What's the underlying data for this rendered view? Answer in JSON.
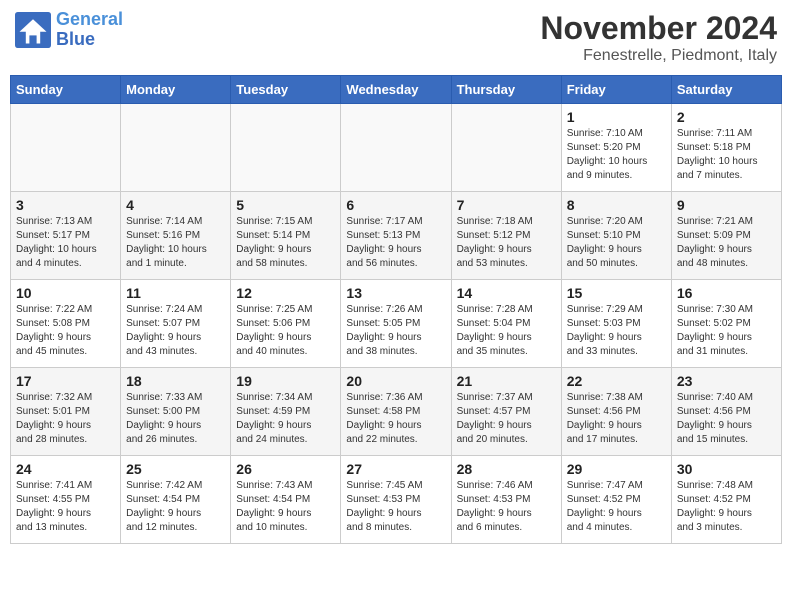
{
  "header": {
    "logo_text_general": "General",
    "logo_text_blue": "Blue",
    "month": "November 2024",
    "location": "Fenestrelle, Piedmont, Italy"
  },
  "weekdays": [
    "Sunday",
    "Monday",
    "Tuesday",
    "Wednesday",
    "Thursday",
    "Friday",
    "Saturday"
  ],
  "weeks": [
    [
      {
        "day": "",
        "info": ""
      },
      {
        "day": "",
        "info": ""
      },
      {
        "day": "",
        "info": ""
      },
      {
        "day": "",
        "info": ""
      },
      {
        "day": "",
        "info": ""
      },
      {
        "day": "1",
        "info": "Sunrise: 7:10 AM\nSunset: 5:20 PM\nDaylight: 10 hours\nand 9 minutes."
      },
      {
        "day": "2",
        "info": "Sunrise: 7:11 AM\nSunset: 5:18 PM\nDaylight: 10 hours\nand 7 minutes."
      }
    ],
    [
      {
        "day": "3",
        "info": "Sunrise: 7:13 AM\nSunset: 5:17 PM\nDaylight: 10 hours\nand 4 minutes."
      },
      {
        "day": "4",
        "info": "Sunrise: 7:14 AM\nSunset: 5:16 PM\nDaylight: 10 hours\nand 1 minute."
      },
      {
        "day": "5",
        "info": "Sunrise: 7:15 AM\nSunset: 5:14 PM\nDaylight: 9 hours\nand 58 minutes."
      },
      {
        "day": "6",
        "info": "Sunrise: 7:17 AM\nSunset: 5:13 PM\nDaylight: 9 hours\nand 56 minutes."
      },
      {
        "day": "7",
        "info": "Sunrise: 7:18 AM\nSunset: 5:12 PM\nDaylight: 9 hours\nand 53 minutes."
      },
      {
        "day": "8",
        "info": "Sunrise: 7:20 AM\nSunset: 5:10 PM\nDaylight: 9 hours\nand 50 minutes."
      },
      {
        "day": "9",
        "info": "Sunrise: 7:21 AM\nSunset: 5:09 PM\nDaylight: 9 hours\nand 48 minutes."
      }
    ],
    [
      {
        "day": "10",
        "info": "Sunrise: 7:22 AM\nSunset: 5:08 PM\nDaylight: 9 hours\nand 45 minutes."
      },
      {
        "day": "11",
        "info": "Sunrise: 7:24 AM\nSunset: 5:07 PM\nDaylight: 9 hours\nand 43 minutes."
      },
      {
        "day": "12",
        "info": "Sunrise: 7:25 AM\nSunset: 5:06 PM\nDaylight: 9 hours\nand 40 minutes."
      },
      {
        "day": "13",
        "info": "Sunrise: 7:26 AM\nSunset: 5:05 PM\nDaylight: 9 hours\nand 38 minutes."
      },
      {
        "day": "14",
        "info": "Sunrise: 7:28 AM\nSunset: 5:04 PM\nDaylight: 9 hours\nand 35 minutes."
      },
      {
        "day": "15",
        "info": "Sunrise: 7:29 AM\nSunset: 5:03 PM\nDaylight: 9 hours\nand 33 minutes."
      },
      {
        "day": "16",
        "info": "Sunrise: 7:30 AM\nSunset: 5:02 PM\nDaylight: 9 hours\nand 31 minutes."
      }
    ],
    [
      {
        "day": "17",
        "info": "Sunrise: 7:32 AM\nSunset: 5:01 PM\nDaylight: 9 hours\nand 28 minutes."
      },
      {
        "day": "18",
        "info": "Sunrise: 7:33 AM\nSunset: 5:00 PM\nDaylight: 9 hours\nand 26 minutes."
      },
      {
        "day": "19",
        "info": "Sunrise: 7:34 AM\nSunset: 4:59 PM\nDaylight: 9 hours\nand 24 minutes."
      },
      {
        "day": "20",
        "info": "Sunrise: 7:36 AM\nSunset: 4:58 PM\nDaylight: 9 hours\nand 22 minutes."
      },
      {
        "day": "21",
        "info": "Sunrise: 7:37 AM\nSunset: 4:57 PM\nDaylight: 9 hours\nand 20 minutes."
      },
      {
        "day": "22",
        "info": "Sunrise: 7:38 AM\nSunset: 4:56 PM\nDaylight: 9 hours\nand 17 minutes."
      },
      {
        "day": "23",
        "info": "Sunrise: 7:40 AM\nSunset: 4:56 PM\nDaylight: 9 hours\nand 15 minutes."
      }
    ],
    [
      {
        "day": "24",
        "info": "Sunrise: 7:41 AM\nSunset: 4:55 PM\nDaylight: 9 hours\nand 13 minutes."
      },
      {
        "day": "25",
        "info": "Sunrise: 7:42 AM\nSunset: 4:54 PM\nDaylight: 9 hours\nand 12 minutes."
      },
      {
        "day": "26",
        "info": "Sunrise: 7:43 AM\nSunset: 4:54 PM\nDaylight: 9 hours\nand 10 minutes."
      },
      {
        "day": "27",
        "info": "Sunrise: 7:45 AM\nSunset: 4:53 PM\nDaylight: 9 hours\nand 8 minutes."
      },
      {
        "day": "28",
        "info": "Sunrise: 7:46 AM\nSunset: 4:53 PM\nDaylight: 9 hours\nand 6 minutes."
      },
      {
        "day": "29",
        "info": "Sunrise: 7:47 AM\nSunset: 4:52 PM\nDaylight: 9 hours\nand 4 minutes."
      },
      {
        "day": "30",
        "info": "Sunrise: 7:48 AM\nSunset: 4:52 PM\nDaylight: 9 hours\nand 3 minutes."
      }
    ]
  ]
}
